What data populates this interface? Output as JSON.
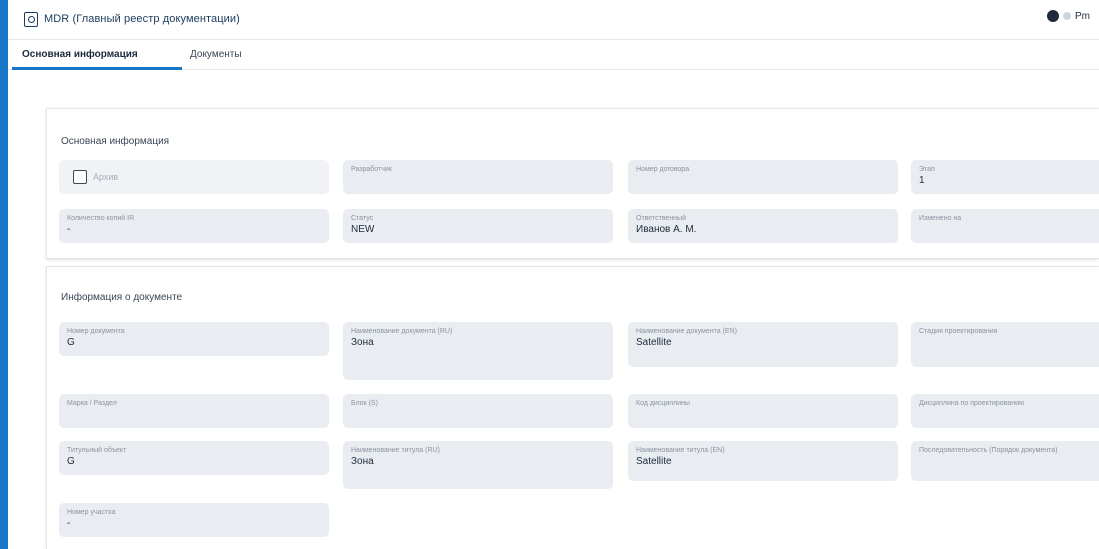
{
  "header": {
    "title": "MDR (Главный реестр документации)",
    "user_name": "Pm"
  },
  "tabs": [
    {
      "label": "Основная информация",
      "active": true
    },
    {
      "label": "Документы",
      "active": false
    }
  ],
  "section_main": {
    "title": "Основная информация",
    "checkbox": {
      "label": "Архив",
      "checked": false
    },
    "fields": [
      {
        "label": "Разработчик",
        "value": ""
      },
      {
        "label": "Номер договора",
        "value": ""
      },
      {
        "label": "Этап",
        "value": "1"
      },
      {
        "label": "Количество копий IR",
        "value": "-"
      },
      {
        "label": "Статус",
        "value": "NEW"
      },
      {
        "label": "Ответственный",
        "value": "Иванов А. М."
      },
      {
        "label": "Изменено на",
        "value": ""
      }
    ]
  },
  "section_doc": {
    "title": "Информация о документе",
    "fields": [
      {
        "label": "Номер документа",
        "value": "G"
      },
      {
        "label": "Наименование документа (RU)",
        "value": "Зона"
      },
      {
        "label": "Наименование документа (EN)",
        "value": "Satellite"
      },
      {
        "label": "Стадия проектирования",
        "value": ""
      },
      {
        "label": "Марка / Раздел",
        "value": ""
      },
      {
        "label": "Блок (S)",
        "value": ""
      },
      {
        "label": "Код дисциплины",
        "value": ""
      },
      {
        "label": "Дисциплина по проектированию",
        "value": ""
      },
      {
        "label": "Титульный объект",
        "value": "G"
      },
      {
        "label": "Наименование титула (RU)",
        "value": "Зона"
      },
      {
        "label": "Наименование титула (EN)",
        "value": "Satellite"
      },
      {
        "label": "Последовательность (Порядок документа)",
        "value": ""
      },
      {
        "label": "Номер участка",
        "value": "-"
      }
    ]
  },
  "colors": {
    "accent": "#1877c9",
    "field_bg": "#e9ecf1"
  }
}
